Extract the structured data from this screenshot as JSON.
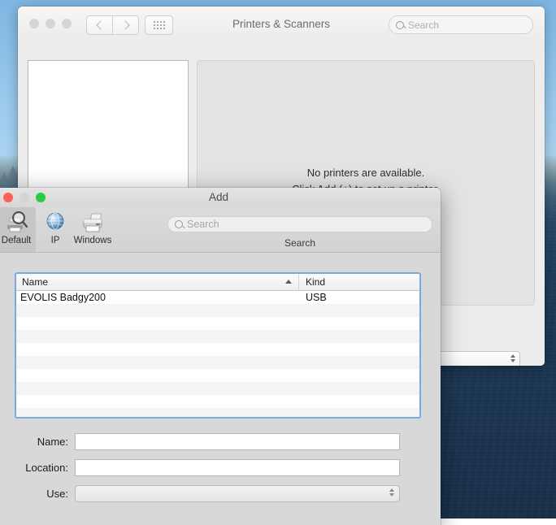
{
  "prefs_window": {
    "title": "Printers & Scanners",
    "traffic_lights": [
      "close",
      "minimize",
      "zoom"
    ],
    "nav": {
      "back_icon": "chevron-left-icon",
      "forward_icon": "chevron-right-icon",
      "grid_icon": "grid-view-icon"
    },
    "search": {
      "placeholder": "Search",
      "value": "",
      "icon": "search-icon"
    },
    "empty_state": {
      "line1": "No printers are available.",
      "line2": "Click Add (+) to set up a printer."
    },
    "help_button_label": "?"
  },
  "add_dialog": {
    "title": "Add",
    "traffic_lights": {
      "close": "close",
      "minimize_disabled": "minimize",
      "zoom": "zoom"
    },
    "toolbar": {
      "items": [
        {
          "label": "Default",
          "icon": "default-printer-icon",
          "selected": true
        },
        {
          "label": "IP",
          "icon": "ip-globe-icon",
          "selected": false
        },
        {
          "label": "Windows",
          "icon": "windows-printer-icon",
          "selected": false
        }
      ],
      "search": {
        "placeholder": "Search",
        "value": "",
        "icon": "search-icon",
        "caption": "Search"
      }
    },
    "table": {
      "columns": [
        "Name",
        "Kind"
      ],
      "sort_column": "Name",
      "sort_direction": "ascending",
      "rows": [
        {
          "name": "EVOLIS Badgy200",
          "kind": "USB"
        }
      ],
      "empty_row_count": 9
    },
    "form": {
      "fields": [
        {
          "label": "Name:",
          "value": "",
          "type": "text"
        },
        {
          "label": "Location:",
          "value": "",
          "type": "text"
        },
        {
          "label": "Use:",
          "value": "",
          "type": "popup"
        }
      ]
    }
  },
  "colors": {
    "focus_ring": "#7aa9e0",
    "close_red": "#fc5f57",
    "zoom_green": "#2bcb42",
    "disabled_gray": "#d4d4d4",
    "dialog_bg": "#d8d8d8",
    "window_bg": "#ececec",
    "wallpaper_sky": "#8cc0e8",
    "wallpaper_water": "#1d3854"
  }
}
